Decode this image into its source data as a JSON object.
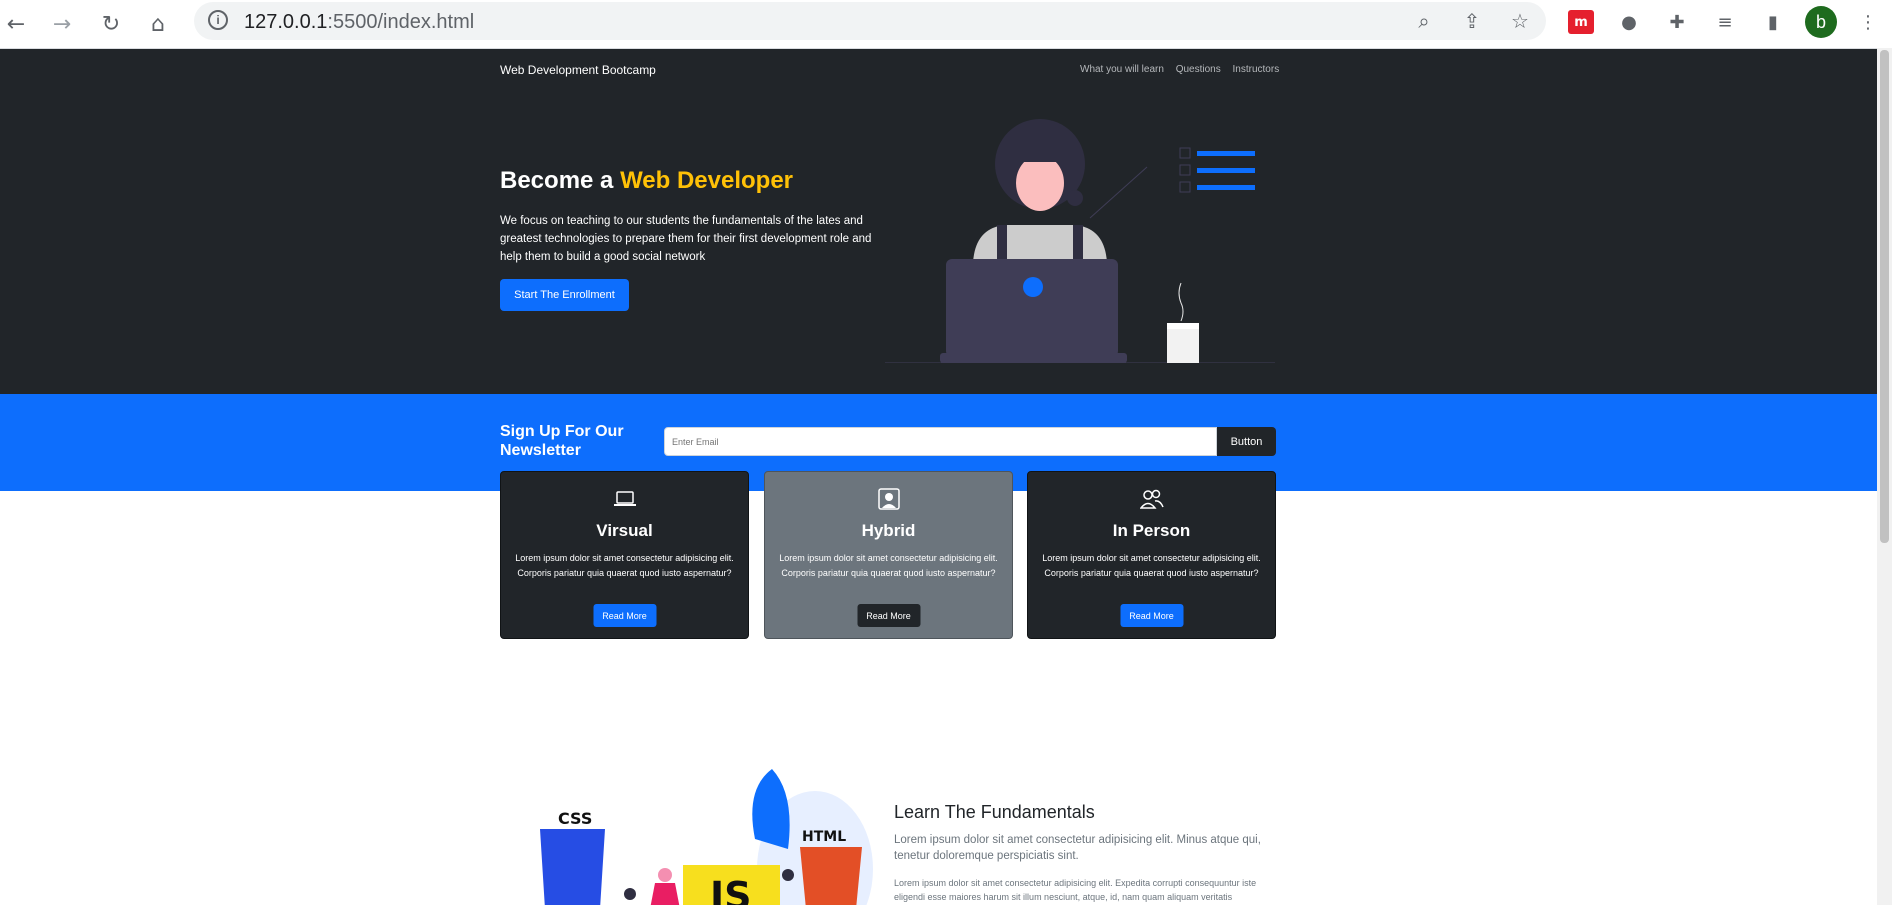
{
  "browser": {
    "url_host": "127.0.0.1",
    "url_path": ":5500/index.html",
    "profile_initial": "b",
    "extension_label": "m"
  },
  "navbar": {
    "brand": "Web Development Bootcamp",
    "links": [
      "What you will learn",
      "Questions",
      "Instructors"
    ]
  },
  "hero": {
    "title_prefix": "Become a ",
    "title_accent": "Web Developer",
    "description": "We focus on teaching to our students the fundamentals of the lates and greatest technologies to prepare them for their first development role and help them to build a good social network",
    "cta_label": "Start The Enrollment"
  },
  "newsletter": {
    "title": "Sign Up For Our Newsletter",
    "placeholder": "Enter Email",
    "button_label": "Button"
  },
  "cards": [
    {
      "icon": "laptop-icon",
      "title": "Virsual",
      "text": "Lorem ipsum dolor sit amet consectetur adipisicing elit. Corporis pariatur quia quaerat quod iusto aspernatur?",
      "button": "Read More"
    },
    {
      "icon": "person-badge-icon",
      "title": "Hybrid",
      "text": "Lorem ipsum dolor sit amet consectetur adipisicing elit. Corporis pariatur quia quaerat quod iusto aspernatur?",
      "button": "Read More"
    },
    {
      "icon": "people-icon",
      "title": "In Person",
      "text": "Lorem ipsum dolor sit amet consectetur adipisicing elit. Corporis pariatur quia quaerat quod iusto aspernatur?",
      "button": "Read More"
    }
  ],
  "learn": {
    "title": "Learn The Fundamentals",
    "lead": "Lorem ipsum dolor sit amet consectetur adipisicing elit. Minus atque qui, tenetur doloremque perspiciatis sint.",
    "body": "Lorem ipsum dolor sit amet consectetur adipisicing elit. Expedita corrupti consequuntur iste eligendi esse maiores harum sit illum nesciunt, atque, id, nam quam aliquam veritatis",
    "logo_css": "CSS",
    "logo_js": "JS",
    "logo_html": "HTML"
  },
  "colors": {
    "primary": "#0d6efd",
    "dark": "#212529",
    "accent": "#ffc107",
    "grey": "#6c757d"
  }
}
